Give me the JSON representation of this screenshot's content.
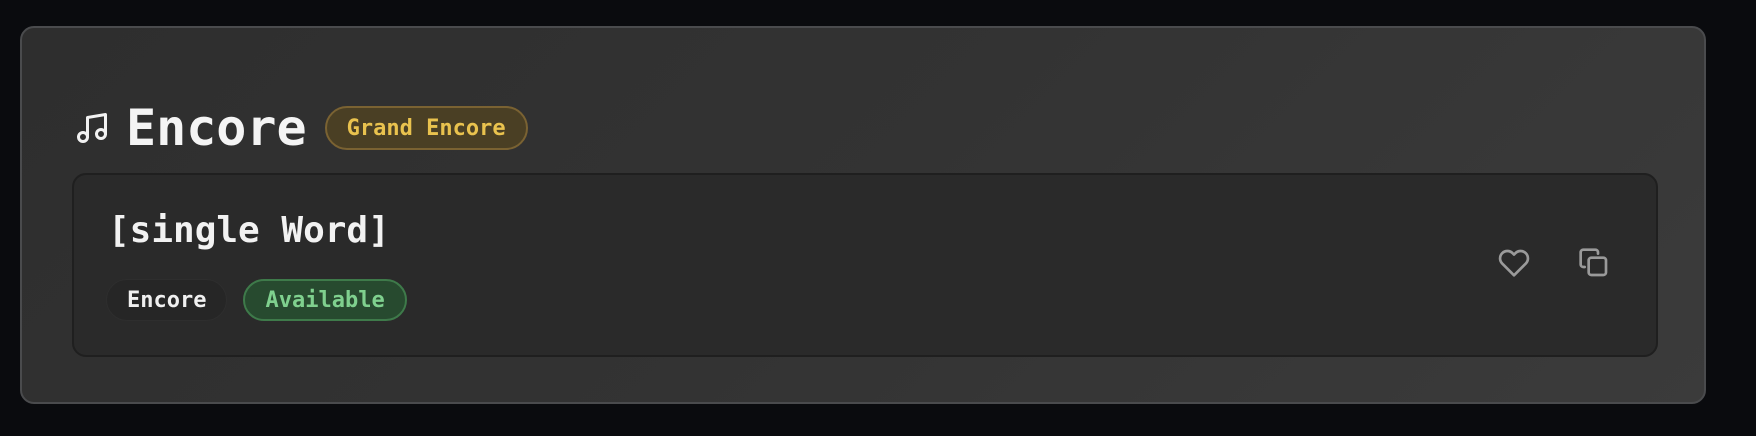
{
  "section": {
    "title": "Encore",
    "badge": "Grand Encore",
    "icon": "music-note-icon"
  },
  "item": {
    "word": "[single Word]",
    "tags": {
      "category": "Encore",
      "status": "Available"
    },
    "actions": {
      "favorite_icon": "heart-icon",
      "copy_icon": "copy-icon"
    }
  },
  "colors": {
    "badge_text": "#e9c24e",
    "status_text": "#7fd08e",
    "panel_border": "#4a4b4d"
  }
}
